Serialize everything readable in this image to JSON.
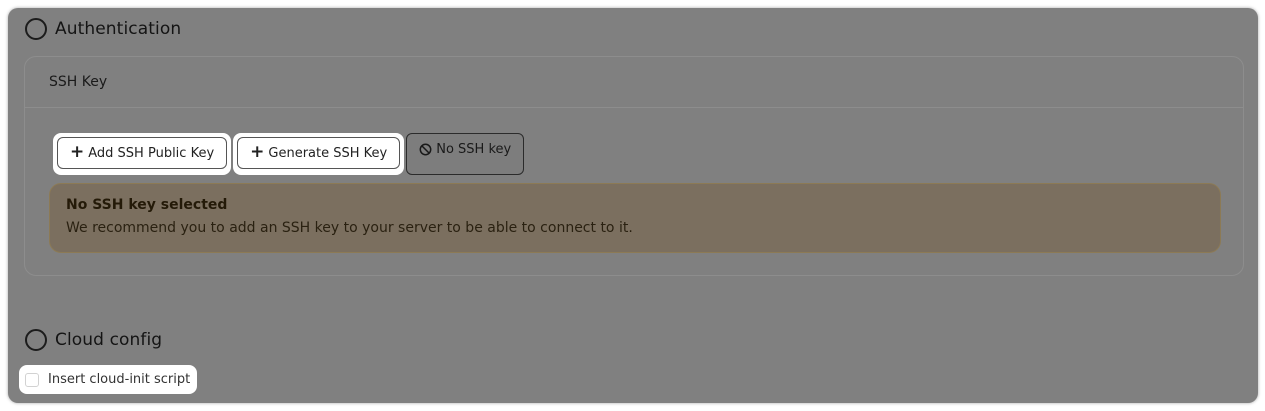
{
  "authentication": {
    "title": "Authentication",
    "card_header": "SSH Key",
    "buttons": {
      "add_key": "Add SSH Public Key",
      "generate_key": "Generate SSH Key",
      "no_key": "No SSH key"
    },
    "alert": {
      "title": "No SSH key selected",
      "message": "We recommend you to add an SSH key to your server to be able to connect to it."
    }
  },
  "cloud_config": {
    "title": "Cloud config",
    "checkbox_label": "Insert cloud-init script",
    "checkbox_checked": false
  },
  "icons": {
    "add": "plus-icon",
    "generate": "plus-icon",
    "no_key": "ban-icon",
    "section": "circle-icon"
  },
  "colors": {
    "overlay": "#808080",
    "alert_background": "#7b6f5f",
    "alert_border": "#8c7a55"
  }
}
